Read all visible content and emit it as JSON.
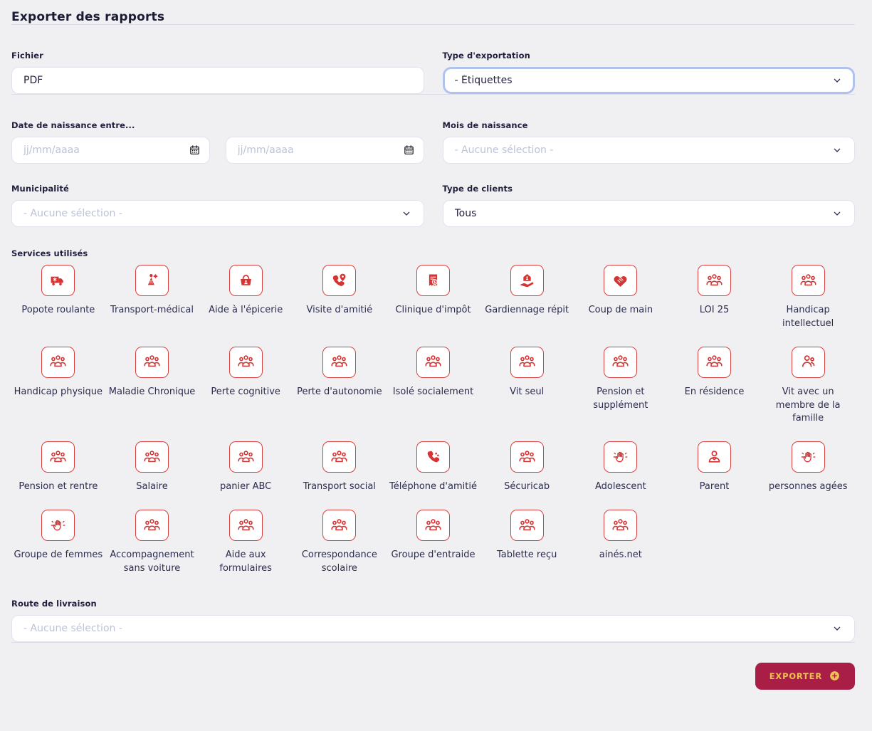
{
  "page": {
    "title": "Exporter des rapports"
  },
  "fields": {
    "fichier": {
      "label": "Fichier",
      "value": "PDF"
    },
    "type_exportation": {
      "label": "Type d'exportation",
      "value": "- Étiquettes"
    },
    "date_naissance": {
      "label": "Date de naissance entre...",
      "placeholder": "jj/mm/aaaa"
    },
    "mois_naissance": {
      "label": "Mois de naissance",
      "value": "- Aucune sélection -"
    },
    "municipalite": {
      "label": "Municipalité",
      "value": "- Aucune sélection -"
    },
    "type_clients": {
      "label": "Type de clients",
      "value": "Tous"
    },
    "route_livraison": {
      "label": "Route de livraison",
      "value": "- Aucune sélection -"
    }
  },
  "services": {
    "label": "Services utilisés",
    "items": [
      {
        "label": "Popote roulante",
        "icon": "truck"
      },
      {
        "label": "Transport-médical",
        "icon": "medical-person"
      },
      {
        "label": "Aide à l'épicerie",
        "icon": "basket"
      },
      {
        "label": "Visite d'amitié",
        "icon": "phone-pin"
      },
      {
        "label": "Clinique d'impôt",
        "icon": "receipt-dollar"
      },
      {
        "label": "Gardiennage répit",
        "icon": "house-hand"
      },
      {
        "label": "Coup de main",
        "icon": "heart-handshake"
      },
      {
        "label": "LOI 25",
        "icon": "people-group"
      },
      {
        "label": "Handicap intellectuel",
        "icon": "people-group"
      },
      {
        "label": "Handicap physique",
        "icon": "people-group"
      },
      {
        "label": "Maladie Chronique",
        "icon": "people-group"
      },
      {
        "label": "Perte cognitive",
        "icon": "people-group"
      },
      {
        "label": "Perte d'autonomie",
        "icon": "people-group"
      },
      {
        "label": "Isolé socialement",
        "icon": "people-group"
      },
      {
        "label": "Vit seul",
        "icon": "people-group"
      },
      {
        "label": "Pension et supplément",
        "icon": "people-group"
      },
      {
        "label": "En résidence",
        "icon": "people-group"
      },
      {
        "label": "Vit avec un membre de la famille",
        "icon": "two-people"
      },
      {
        "label": "Pension et rentre",
        "icon": "people-group"
      },
      {
        "label": "Salaire",
        "icon": "people-group"
      },
      {
        "label": "panier ABC",
        "icon": "people-group"
      },
      {
        "label": "Transport social",
        "icon": "people-group"
      },
      {
        "label": "Téléphone d'amitié",
        "icon": "phone-solid"
      },
      {
        "label": "Sécuricab",
        "icon": "people-group"
      },
      {
        "label": "Adolescent",
        "icon": "raised-hand"
      },
      {
        "label": "Parent",
        "icon": "person"
      },
      {
        "label": "personnes agées",
        "icon": "raised-hand"
      },
      {
        "label": "Groupe de femmes",
        "icon": "raised-hand"
      },
      {
        "label": "Accompagnement sans voiture",
        "icon": "people-group"
      },
      {
        "label": "Aide aux formulaires",
        "icon": "people-group"
      },
      {
        "label": "Correspondance scolaire",
        "icon": "people-group"
      },
      {
        "label": "Groupe d'entraide",
        "icon": "people-group"
      },
      {
        "label": "Tablette reçu",
        "icon": "people-group"
      },
      {
        "label": "ainés.net",
        "icon": "people-group"
      }
    ]
  },
  "footer": {
    "export_label": "EXPORTER"
  },
  "colors": {
    "background": "#f0f0f2",
    "accent_red": "#d63333",
    "button_bg": "#a81e46",
    "button_text": "#f0c052",
    "focus_ring": "#b2c2ef",
    "placeholder": "#bcc3d6",
    "text_navy": "#21213f"
  }
}
